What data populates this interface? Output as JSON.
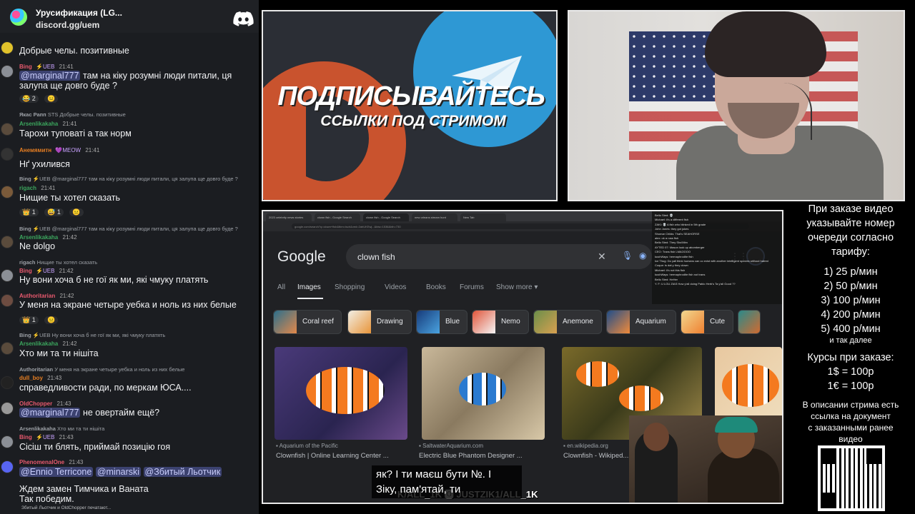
{
  "chat": {
    "server_name": "Урусификация (LG...",
    "server_invite": "discord.gg/uem",
    "messages": [
      {
        "text": "Добрые челы. позитивные"
      },
      {
        "author": "Bing",
        "badge": "⚡UEB",
        "time": "21:41",
        "mention": "@marginal777",
        "text": "там на кіку розумні люди питали, ця залупа ще довго буде ?",
        "reactions": [
          "😂 2",
          "😐"
        ]
      },
      {
        "reply_author": "Якас Рапп",
        "reply_badge": "STS",
        "reply_text": "Добрые челы. позитивные",
        "author": "Arsenlikakaha",
        "time": "21:41",
        "text": "Тарохи туповаті  а так норм"
      },
      {
        "author": "Анемямитн",
        "badge": "💜MEOW",
        "time": "21:41",
        "text": "Нґ ухилився"
      },
      {
        "reply_author": "Bing",
        "reply_badge": "⚡UEB",
        "reply_text": "@marginal777 там на кіку розумні люди питали, ця залупа ще довго буде ?",
        "author": "rigach",
        "time": "21:41",
        "text": "Нищие ты хотел сказать",
        "reactions": [
          "👑 1",
          "😅 1",
          "😐"
        ]
      },
      {
        "reply_author": "Bing",
        "reply_badge": "⚡UEB",
        "reply_text": "@marginal777 там на кіку розумні люди питали, ця залупа ще довго буде ?",
        "author": "Arsenlikakaha",
        "time": "21:42",
        "text": "Ne dolgo"
      },
      {
        "reply_author": "rigach",
        "reply_text": "Нищие ты хотел сказать",
        "author": "Bing",
        "badge": "⚡UEB",
        "time": "21:42",
        "text": "Ну вони хоча б не гої як ми, які чмуку платять"
      },
      {
        "author": "Authoritarian",
        "time": "21:42",
        "text": "У меня на экране четыре уебка и ноль из них белые",
        "reactions": [
          "👑 1",
          "😐"
        ]
      },
      {
        "reply_author": "Bing",
        "reply_badge": "⚡UEB",
        "reply_text": "Ну вони хоча б не гої як ми, які чмуку платять",
        "author": "Arsenlikakaha",
        "time": "21:42",
        "text": "Хто ми та ти нішіта"
      },
      {
        "reply_author": "Authoritarian",
        "reply_text": "У меня на экране четыре уебка и ноль из них белые",
        "author": "dull_boy",
        "time": "21:43",
        "text": "справедливости ради, по меркам ЮСА...."
      },
      {
        "author": "OldChopper",
        "time": "21:43",
        "mention": "@marginal777",
        "text": "не овертайм ещё?"
      },
      {
        "reply_author": "Arsenlikakaha",
        "reply_text": "Хто ми та ти нішіта",
        "author": "Bing",
        "badge": "⚡UEB",
        "time": "21:43",
        "text": "Сісіш ти блять, приймай позицію гоя"
      },
      {
        "author": "PhenomenalOne",
        "time": "21:43",
        "mentions": [
          "@Ennio Terricone",
          "@minarski",
          "@Збитый Льотчик"
        ],
        "text": "Ждем замен Тимчика и Ваната\nТак победим."
      }
    ],
    "typing": "Збитый Льотчик и OldChopper печатают..."
  },
  "promo": {
    "title": "ПОДПИСЫВАЙТЕСЬ",
    "subtitle": "ССЫЛКИ ПОД СТРИМОМ"
  },
  "browser": {
    "tabs": [
      "2023 celebrity news stories",
      "clown fish - Google Search",
      "clown fish - Google Search",
      "new orleans stream hunt",
      "New Tab"
    ],
    "url": "google.com/search?q=clown+fish&tbm=isch&ved=2ahUKEwj...&biw=1536&bih=730",
    "search_query": "clown fish",
    "nav": [
      "All",
      "Images",
      "Shopping",
      "Videos",
      "Books",
      "Forums",
      "Show more"
    ],
    "active_nav": "Images",
    "chips": [
      "Coral reef",
      "Drawing",
      "Blue",
      "Nemo",
      "Anemone",
      "Aquarium",
      "Cute"
    ],
    "results": [
      {
        "source": "Aquarium of the Pacific",
        "title": "Clownfish | Online Learning Center ..."
      },
      {
        "source": "SaltwaterAquarium.com",
        "title": "Electric Blue Phantom Designer ..."
      },
      {
        "source": "en.wikipedia.org",
        "title": "Clownfish - Wikiped..."
      }
    ],
    "overlay_chat": [
      "Bello Sted: 💀",
      "Michael: it's a different fish",
      "ZAKI: 💀 A fish who blinked in 5th grade",
      "John Jones: they got jokes",
      "Shomar Childs: That's SEAHORSE",
      "alex: ok a ross fish",
      "Bello Sted: They Sha'Mim",
      "AYTED 07: Mason look up abomberger",
      "CEO: Trans fish LMAOOOO",
      "kushWays: hermaphrodite fish",
      "Ice Thug: Do yall think humans can co exist with another intelligent species without hatred",
      "Coque: is dat y they clown",
      "Michael: it's not this fish",
      "kushWays: hermaphrodite fish not trans",
      "Bello Sted: HeHer",
      "Y. F: U LOU ZIAS How y'all doing Pablo Herb's Ta y'all Good ??"
    ],
    "subtitle": "як?  І ти маєш бути №. І\nЗіку, пам'ятай, ти",
    "watermark": "K/ALL_1K 🅾 JUSTZIK1/ALL_1K"
  },
  "pricing": {
    "intro": [
      "При заказе видео",
      "указывайте номер",
      "очереди согласно",
      "тарифу:"
    ],
    "tiers": [
      "1) 25 р/мин",
      "2) 50 р/мин",
      "3) 100 р/мин",
      "4) 200 р/мин",
      "5) 400 р/мин"
    ],
    "etc": "и так далее",
    "rates_title": "Курсы при заказе:",
    "rates": [
      "1$ = 100р",
      "1€ = 100р"
    ],
    "note": [
      "В описании стрима есть",
      "ссылка на документ",
      "с заказанными ранее",
      "видео"
    ]
  }
}
